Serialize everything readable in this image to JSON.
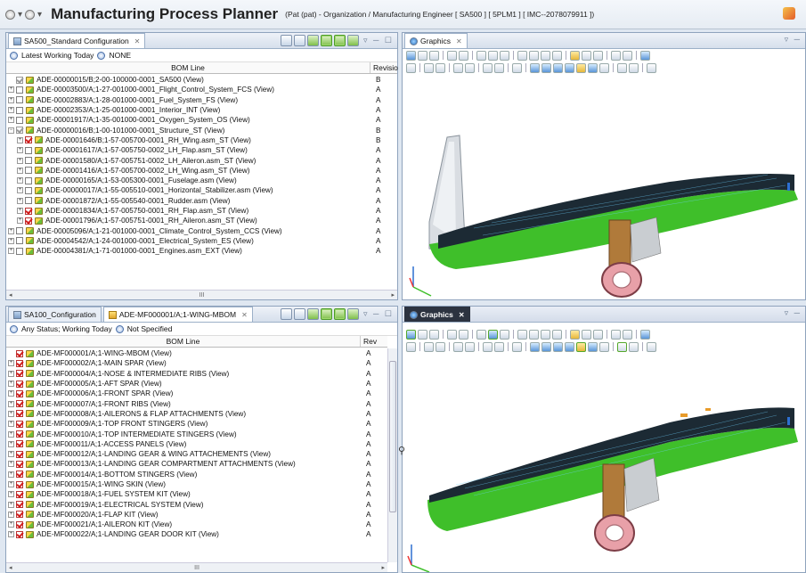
{
  "titlebar": {
    "title": "Manufacturing Process Planner",
    "context": "(Pat (pat) - Organization / Manufacturing Engineer  [ SA500 ]  [ 5PLM1 ]  [ IMC--2078079911 ])"
  },
  "top_left": {
    "tab": "SA500_Standard Configuration",
    "filter": "Latest Working Today",
    "filter_value": "NONE",
    "col_bom": "BOM Line",
    "col_rev": "Revisio",
    "rows": [
      {
        "text": "ADE-00000015/B;2-00-100000-0001_SA500 (View)",
        "rev": "B",
        "level": 0,
        "ex": "",
        "chk": "grey"
      },
      {
        "text": "ADE-00003500/A;1-27-001000-0001_Flight_Control_System_FCS (View)",
        "rev": "A",
        "level": 0,
        "ex": "+",
        "chk": "off"
      },
      {
        "text": "ADE-00002883/A;1-28-001000-0001_Fuel_System_FS (View)",
        "rev": "A",
        "level": 0,
        "ex": "+",
        "chk": "off"
      },
      {
        "text": "ADE-00002353/A;1-25-001000-0001_Interior_INT (View)",
        "rev": "A",
        "level": 0,
        "ex": "+",
        "chk": "off"
      },
      {
        "text": "ADE-00001917/A;1-35-001000-0001_Oxygen_System_OS (View)",
        "rev": "A",
        "level": 0,
        "ex": "+",
        "chk": "off"
      },
      {
        "text": "ADE-00000016/B;1-00-101000-0001_Structure_ST (View)",
        "rev": "B",
        "level": 0,
        "ex": "-",
        "chk": "grey"
      },
      {
        "text": "ADE-00001646/B;1-57-005700-0001_RH_Wing.asm_ST (View)",
        "rev": "B",
        "level": 1,
        "ex": "+",
        "chk": "on"
      },
      {
        "text": "ADE-00001617/A;1-57-005750-0002_LH_Flap.asm_ST (View)",
        "rev": "A",
        "level": 1,
        "ex": "+",
        "chk": "off"
      },
      {
        "text": "ADE-00001580/A;1-57-005751-0002_LH_Aileron.asm_ST (View)",
        "rev": "A",
        "level": 1,
        "ex": "+",
        "chk": "off"
      },
      {
        "text": "ADE-00001416/A;1-57-005700-0002_LH_Wing.asm_ST (View)",
        "rev": "A",
        "level": 1,
        "ex": "+",
        "chk": "off"
      },
      {
        "text": "ADE-00000165/A;1-53-005300-0001_Fuselage.asm (View)",
        "rev": "A",
        "level": 1,
        "ex": "+",
        "chk": "off"
      },
      {
        "text": "ADE-00000017/A;1-55-005510-0001_Horizontal_Stabilizer.asm (View)",
        "rev": "A",
        "level": 1,
        "ex": "+",
        "chk": "off"
      },
      {
        "text": "ADE-00001872/A;1-55-005540-0001_Rudder.asm (View)",
        "rev": "A",
        "level": 1,
        "ex": "+",
        "chk": "off"
      },
      {
        "text": "ADE-00001834/A;1-57-005750-0001_RH_Flap.asm_ST (View)",
        "rev": "A",
        "level": 1,
        "ex": "+",
        "chk": "on"
      },
      {
        "text": "ADE-00001796/A;1-57-005751-0001_RH_Aileron.asm_ST (View)",
        "rev": "A",
        "level": 1,
        "ex": "+",
        "chk": "on"
      },
      {
        "text": "ADE-00005096/A;1-21-001000-0001_Climate_Control_System_CCS (View)",
        "rev": "A",
        "level": 0,
        "ex": "+",
        "chk": "off"
      },
      {
        "text": "ADE-00004542/A;1-24-001000-0001_Electrical_System_ES (View)",
        "rev": "A",
        "level": 0,
        "ex": "+",
        "chk": "off"
      },
      {
        "text": "ADE-00004381/A;1-71-001000-0001_Engines.asm_EXT (View)",
        "rev": "A",
        "level": 0,
        "ex": "+",
        "chk": "off"
      }
    ]
  },
  "bottom_left": {
    "tab1": "SA100_Configuration",
    "tab2": "ADE-MF000001/A;1-WING-MBOM",
    "filter": "Any Status; Working Today",
    "filter_value": "Not Specified",
    "col_bom": "BOM Line",
    "col_rev": "Rev",
    "rows": [
      {
        "text": "ADE-MF000001/A;1-WING-MBOM (View)",
        "rev": "A",
        "level": 0,
        "ex": "",
        "chk": "on"
      },
      {
        "text": "ADE-MF000002/A;1-MAIN SPAR (View)",
        "rev": "A",
        "level": 0,
        "ex": "+",
        "chk": "on"
      },
      {
        "text": "ADE-MF000004/A;1-NOSE & INTERMEDIATE RIBS (View)",
        "rev": "A",
        "level": 0,
        "ex": "+",
        "chk": "on"
      },
      {
        "text": "ADE-MF000005/A;1-AFT SPAR (View)",
        "rev": "A",
        "level": 0,
        "ex": "+",
        "chk": "on"
      },
      {
        "text": "ADE-MF000006/A;1-FRONT SPAR (View)",
        "rev": "A",
        "level": 0,
        "ex": "+",
        "chk": "on"
      },
      {
        "text": "ADE-MF000007/A;1-FRONT RIBS (View)",
        "rev": "A",
        "level": 0,
        "ex": "+",
        "chk": "on"
      },
      {
        "text": "ADE-MF000008/A;1-AILERONS & FLAP ATTACHMENTS (View)",
        "rev": "A",
        "level": 0,
        "ex": "+",
        "chk": "on"
      },
      {
        "text": "ADE-MF000009/A;1-TOP FRONT STINGERS (View)",
        "rev": "A",
        "level": 0,
        "ex": "+",
        "chk": "on"
      },
      {
        "text": "ADE-MF000010/A;1-TOP INTERMEDIATE STINGERS (View)",
        "rev": "A",
        "level": 0,
        "ex": "+",
        "chk": "on"
      },
      {
        "text": "ADE-MF000011/A;1-ACCESS PANELS (View)",
        "rev": "A",
        "level": 0,
        "ex": "+",
        "chk": "on"
      },
      {
        "text": "ADE-MF000012/A;1-LANDING GEAR & WING ATTACHEMENTS (View)",
        "rev": "A",
        "level": 0,
        "ex": "+",
        "chk": "on"
      },
      {
        "text": "ADE-MF000013/A;1-LANDING GEAR COMPARTMENT ATTACHMENTS (View)",
        "rev": "A",
        "level": 0,
        "ex": "+",
        "chk": "on"
      },
      {
        "text": "ADE-MF000014/A;1-BOTTOM STINGERS (View)",
        "rev": "A",
        "level": 0,
        "ex": "+",
        "chk": "on"
      },
      {
        "text": "ADE-MF000015/A;1-WING SKIN (View)",
        "rev": "A",
        "level": 0,
        "ex": "+",
        "chk": "on"
      },
      {
        "text": "ADE-MF000018/A;1-FUEL SYSTEM KIT (View)",
        "rev": "A",
        "level": 0,
        "ex": "+",
        "chk": "on"
      },
      {
        "text": "ADE-MF000019/A;1-ELECTRICAL SYSTEM (View)",
        "rev": "A",
        "level": 0,
        "ex": "+",
        "chk": "on"
      },
      {
        "text": "ADE-MF000020/A;1-FLAP KIT (View)",
        "rev": "A",
        "level": 0,
        "ex": "+",
        "chk": "on"
      },
      {
        "text": "ADE-MF000021/A;1-AILERON KIT (View)",
        "rev": "A",
        "level": 0,
        "ex": "+",
        "chk": "on"
      },
      {
        "text": "ADE-MF000022/A;1-LANDING GEAR DOOR KIT (View)",
        "rev": "A",
        "level": 0,
        "ex": "+",
        "chk": "on"
      }
    ]
  },
  "graphics_top": {
    "tab": "Graphics"
  },
  "graphics_bottom": {
    "tab": "Graphics"
  },
  "scroll_marker": "III",
  "colors": {
    "wing": "#3fbf2a",
    "accent": "#2d6fd1",
    "tire": "#e8a0a8"
  }
}
